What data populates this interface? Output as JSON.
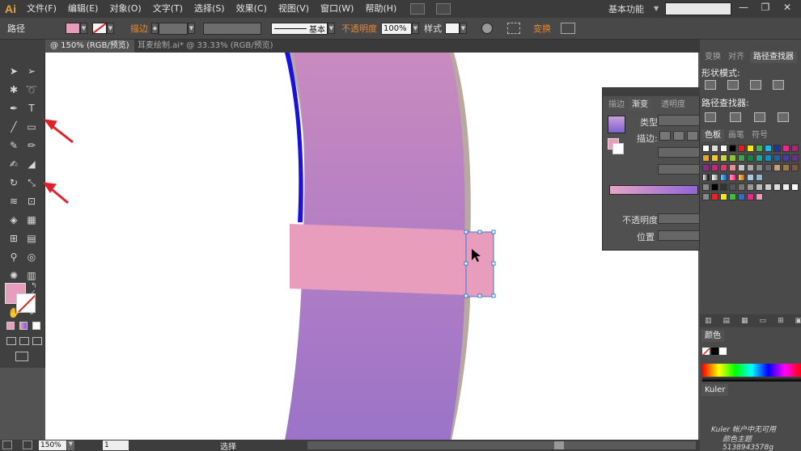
{
  "app": {
    "logo": "Ai",
    "menu": [
      "文件(F)",
      "编辑(E)",
      "对象(O)",
      "文字(T)",
      "选择(S)",
      "效果(C)",
      "视图(V)",
      "窗口(W)",
      "帮助(H)"
    ],
    "workspace": "基本功能",
    "window_buttons": [
      "—",
      "❐",
      "✕"
    ]
  },
  "controlbar": {
    "selection_label": "路径",
    "stroke_label": "描边",
    "stroke_style": "基本",
    "opacity_label": "不透明度",
    "opacity_value": "100%",
    "style_label": "样式",
    "transform_label": "变换",
    "fill_color": "#e99bbb"
  },
  "tabs": [
    {
      "label": "@ 150% (RGB/预览)",
      "active": true
    },
    {
      "label": "耳麦绘制.ai* @ 33.33% (RGB/预览)",
      "active": false
    }
  ],
  "colors": {
    "purple_top": "#c98abf",
    "purple_bottom": "#9b73c8",
    "pink_rect": "#e89dbc",
    "blue_edge": "#1a10e0",
    "selection": "#3a7bd5",
    "arrow_red": "#e0202a"
  },
  "right_panel": {
    "top_tabs": [
      "变换",
      "对齐",
      "路径查找器"
    ],
    "shape_mode_label": "形状模式:",
    "pathfinder_label": "路径查找器:",
    "swatch_tabs": [
      "色板",
      "画笔",
      "符号"
    ],
    "color_tab": "颜色",
    "kuler_tab": "Kuler",
    "kuler_text_1": "Kuler 帐户中无可用",
    "kuler_text_2": "颜色主题 5138943578g"
  },
  "gradient_panel": {
    "tabs": [
      "描边",
      "渐变",
      "透明度"
    ],
    "type_label": "类型:",
    "stroke_label": "描边:",
    "opacity_label": "不透明度",
    "position_label": "位置"
  },
  "statusbar": {
    "zoom": "150%",
    "page": "1",
    "mode": "选择"
  }
}
